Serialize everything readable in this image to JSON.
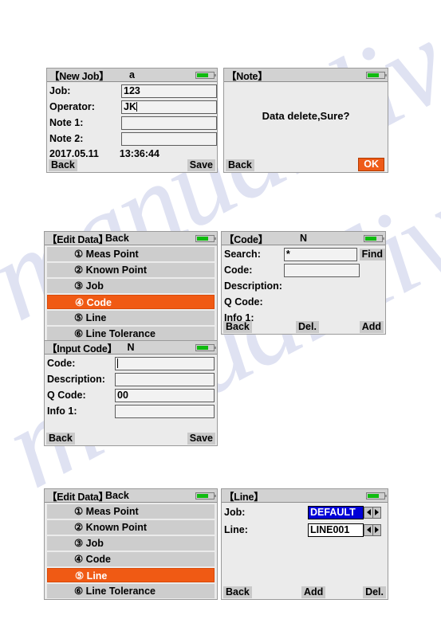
{
  "watermark": {
    "text1": "manualslive.com",
    "text2": "manualslive.com"
  },
  "colors": {
    "accent": "#f05a14",
    "ok_button": "#ee5a18",
    "select_blue": "#0000d8",
    "battery_green": "#10bb10",
    "panel_bg": "#ebebeb",
    "titlebar_bg": "#d2d2d2"
  },
  "panels": {
    "new_job": {
      "title": "【New Job】",
      "indicator": "a",
      "battery": "battery-icon",
      "rows": [
        {
          "label": "Job:",
          "value": "123"
        },
        {
          "label": "Operator:",
          "value": "JK"
        },
        {
          "label": "Note 1:",
          "value": ""
        },
        {
          "label": "Note 2:",
          "value": ""
        }
      ],
      "date": "2017.05.11",
      "time": "13:36:44",
      "softkey_left": "Back",
      "softkey_right": "Save"
    },
    "note": {
      "title": "【Note】",
      "indicator": "",
      "message": "Data delete,Sure?",
      "softkey_left": "Back",
      "softkey_right": "OK"
    },
    "edit_data_code": {
      "title": "【Edit Data】",
      "back_label": "Back",
      "items": [
        {
          "label": "① Meas Point",
          "selected": false
        },
        {
          "label": "② Known Point",
          "selected": false
        },
        {
          "label": "③ Job",
          "selected": false
        },
        {
          "label": "④ Code",
          "selected": true
        },
        {
          "label": "⑤ Line",
          "selected": false
        },
        {
          "label": "⑥ Line Tolerance",
          "selected": false
        }
      ]
    },
    "code": {
      "title": "【Code】",
      "indicator": "N",
      "rows": [
        {
          "label": "Search:",
          "value": "*",
          "widget": "find-button"
        },
        {
          "label": "Code:",
          "value": "",
          "widget": "spinner"
        },
        {
          "label": "Description:",
          "value": "",
          "widget": "none"
        },
        {
          "label": "Q Code:",
          "value": "",
          "widget": "none"
        },
        {
          "label": "Info 1:",
          "value": "",
          "widget": "none"
        }
      ],
      "find_label": "Find",
      "softkey_left": "Back",
      "softkey_mid": "Del.",
      "softkey_right": "Add"
    },
    "input_code": {
      "title": "【Input Code】",
      "indicator": "N",
      "rows": [
        {
          "label": "Code:",
          "value": ""
        },
        {
          "label": "Description:",
          "value": ""
        },
        {
          "label": "Q Code:",
          "value": "00"
        },
        {
          "label": "Info 1:",
          "value": ""
        }
      ],
      "softkey_left": "Back",
      "softkey_right": "Save"
    },
    "edit_data_line": {
      "title": "【Edit Data】",
      "back_label": "Back",
      "items": [
        {
          "label": "① Meas Point",
          "selected": false
        },
        {
          "label": "② Known Point",
          "selected": false
        },
        {
          "label": "③ Job",
          "selected": false
        },
        {
          "label": "④ Code",
          "selected": false
        },
        {
          "label": "⑤ Line",
          "selected": true
        },
        {
          "label": "⑥ Line Tolerance",
          "selected": false
        }
      ]
    },
    "line": {
      "title": "【Line】",
      "indicator": "",
      "rows": [
        {
          "label": "Job:",
          "value": "DEFAULT",
          "highlighted": true
        },
        {
          "label": "Line:",
          "value": "LINE001",
          "highlighted": false
        }
      ],
      "softkey_left": "Back",
      "softkey_mid": "Add",
      "softkey_right": "Del."
    }
  }
}
